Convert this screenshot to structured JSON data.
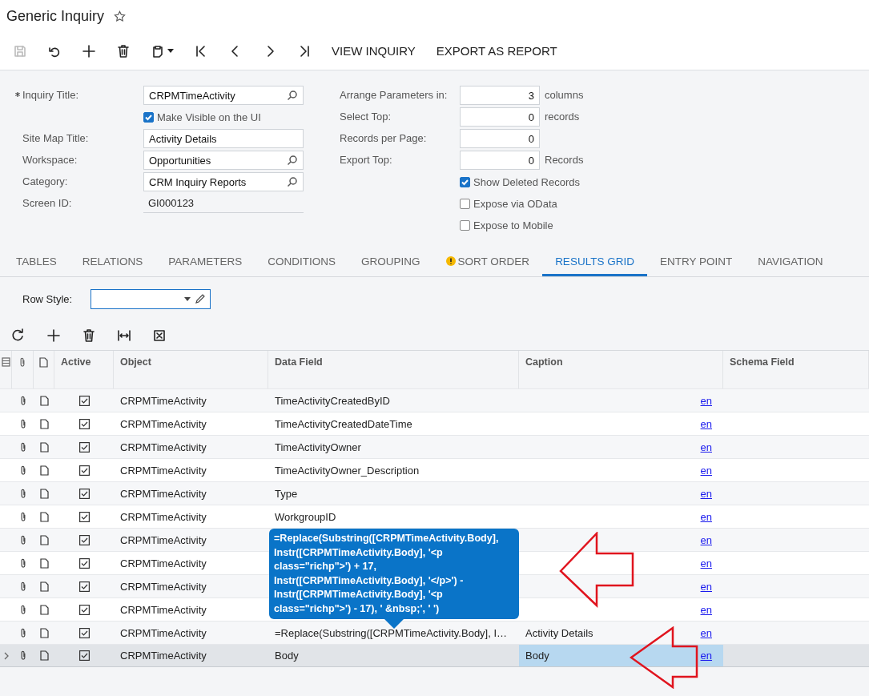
{
  "page": {
    "title": "Generic Inquiry"
  },
  "toolbar": [
    {
      "kind": "save",
      "disabled": true
    },
    {
      "kind": "undo",
      "disabled": false
    },
    {
      "kind": "add",
      "disabled": false
    },
    {
      "kind": "delete",
      "disabled": false
    },
    {
      "kind": "clipboard",
      "disabled": false
    },
    {
      "kind": "first",
      "disabled": false
    },
    {
      "kind": "prev",
      "disabled": false
    },
    {
      "kind": "next",
      "disabled": false
    },
    {
      "kind": "last",
      "disabled": false
    },
    {
      "kind": "text",
      "label": "VIEW INQUIRY",
      "disabled": false
    },
    {
      "kind": "text",
      "label": "EXPORT AS REPORT",
      "disabled": false
    }
  ],
  "form_left": [
    {
      "kind": "lookup",
      "label": "Inquiry Title:",
      "value": "CRPMTimeActivity",
      "required": true
    },
    {
      "kind": "checkbox",
      "label": "Make Visible on the UI",
      "checked": true
    },
    {
      "kind": "text",
      "label": "Site Map Title:",
      "value": "Activity Details",
      "required": false
    },
    {
      "kind": "lookup",
      "label": "Workspace:",
      "value": "Opportunities",
      "required": false
    },
    {
      "kind": "lookup",
      "label": "Category:",
      "value": "CRM Inquiry Reports",
      "required": false
    },
    {
      "kind": "readonly",
      "label": "Screen ID:",
      "value": "GI000123",
      "required": false
    }
  ],
  "form_right": [
    {
      "kind": "number",
      "label": "Arrange Parameters in:",
      "value": "3",
      "unit": "columns"
    },
    {
      "kind": "number",
      "label": "Select Top:",
      "value": "0",
      "unit": "records"
    },
    {
      "kind": "number",
      "label": "Records per Page:",
      "value": "0"
    },
    {
      "kind": "number",
      "label": "Export Top:",
      "value": "0",
      "unit": "Records"
    },
    {
      "kind": "checkbox",
      "label": "Show Deleted Records",
      "checked": true
    },
    {
      "kind": "checkbox",
      "label": "Expose via OData",
      "checked": false
    },
    {
      "kind": "checkbox",
      "label": "Expose to Mobile",
      "checked": false
    }
  ],
  "tabs": [
    {
      "label": "TABLES",
      "selected": false,
      "warning": false
    },
    {
      "label": "RELATIONS",
      "selected": false,
      "warning": false
    },
    {
      "label": "PARAMETERS",
      "selected": false,
      "warning": false
    },
    {
      "label": "CONDITIONS",
      "selected": false,
      "warning": false
    },
    {
      "label": "GROUPING",
      "selected": false,
      "warning": false
    },
    {
      "label": "SORT ORDER",
      "selected": false,
      "warning": true
    },
    {
      "label": "RESULTS GRID",
      "selected": true,
      "warning": false
    },
    {
      "label": "ENTRY POINT",
      "selected": false,
      "warning": false
    },
    {
      "label": "NAVIGATION",
      "selected": false,
      "warning": false
    }
  ],
  "row_style": {
    "label": "Row Style:"
  },
  "grid_toolbar": [
    {
      "kind": "refresh"
    },
    {
      "kind": "add"
    },
    {
      "kind": "delete"
    },
    {
      "kind": "fit"
    },
    {
      "kind": "excel"
    }
  ],
  "columns": [
    "Active",
    "Object",
    "Data Field",
    "Caption",
    "Schema Field"
  ],
  "rows": [
    {
      "active": true,
      "object": "CRPMTimeActivity",
      "data_field": "TimeActivityCreatedByID",
      "link": "en",
      "selected": false,
      "caption_focused": false
    },
    {
      "active": true,
      "object": "CRPMTimeActivity",
      "data_field": "TimeActivityCreatedDateTime",
      "link": "en",
      "selected": false,
      "caption_focused": false
    },
    {
      "active": true,
      "object": "CRPMTimeActivity",
      "data_field": "TimeActivityOwner",
      "link": "en",
      "selected": false,
      "caption_focused": false
    },
    {
      "active": true,
      "object": "CRPMTimeActivity",
      "data_field": "TimeActivityOwner_Description",
      "link": "en",
      "selected": false,
      "caption_focused": false
    },
    {
      "active": true,
      "object": "CRPMTimeActivity",
      "data_field": "Type",
      "link": "en",
      "selected": false,
      "caption_focused": false
    },
    {
      "active": true,
      "object": "CRPMTimeActivity",
      "data_field": "WorkgroupID",
      "link": "en",
      "selected": false,
      "caption_focused": false
    },
    {
      "active": true,
      "object": "CRPMTimeActivity",
      "link": "en",
      "selected": false,
      "caption_focused": false
    },
    {
      "active": true,
      "object": "CRPMTimeActivity",
      "link": "en",
      "selected": false,
      "caption_focused": false
    },
    {
      "active": true,
      "object": "CRPMTimeActivity",
      "link": "en",
      "selected": false,
      "caption_focused": false
    },
    {
      "active": true,
      "object": "CRPMTimeActivity",
      "link": "en",
      "selected": false,
      "caption_focused": false
    },
    {
      "active": true,
      "object": "CRPMTimeActivity",
      "data_field": "=Replace(Substring([CRPMTimeActivity.Body], I…",
      "caption": "Activity Details",
      "link": "en",
      "selected": false,
      "caption_focused": false
    },
    {
      "active": true,
      "object": "CRPMTimeActivity",
      "data_field": "Body",
      "caption": "Body",
      "link": "en",
      "selected": true,
      "caption_focused": true
    }
  ],
  "tooltip": {
    "text": "=Replace(Substring([CRPMTimeActivity.Body], Instr([CRPMTimeActivity.Body], '<p class=\"richp\">') + 17, Instr([CRPMTimeActivity.Body], '</p>') - Instr([CRPMTimeActivity.Body], '<p class=\"richp\">') - 17), ' &nbsp;', ' ')"
  }
}
